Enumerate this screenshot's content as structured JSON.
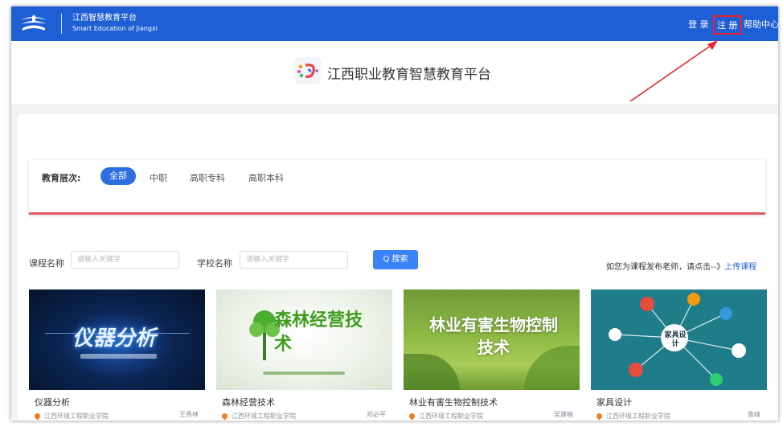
{
  "topbar": {
    "brand_cn": "江西智慧教育平台",
    "brand_en": "Smart Education of Jiangxi",
    "login": "登 录",
    "register": "注 册",
    "help": "帮助中心"
  },
  "platform": {
    "title": "江西职业教育智慧教育平台"
  },
  "filter": {
    "label": "教育层次:",
    "levels": [
      "全部",
      "中职",
      "高职专科",
      "高职本科"
    ],
    "selected": "全部"
  },
  "search": {
    "course_label": "课程名称",
    "course_placeholder": "请输入关键字",
    "school_label": "学校名称",
    "school_placeholder": "请输入关键字",
    "button": "Q 搜索",
    "upload_note": "如您为课程发布老师，请点击--》",
    "upload_link": "上传课程"
  },
  "courses": [
    {
      "title": "仪器分析",
      "school": "江西环境工程职业学院",
      "teacher": "王秀林",
      "thumb_text": "仪器分析"
    },
    {
      "title": "森林经营技术",
      "school": "江西环境工程职业学院",
      "teacher": "邓必平",
      "thumb_text": "森林经营技术"
    },
    {
      "title": "林业有害生物控制技术",
      "school": "江西环境工程职业学院",
      "teacher": "吴建嘛",
      "thumb_text": "林业有害生物控制技术"
    },
    {
      "title": "家具设计",
      "school": "江西环境工程职业学院",
      "teacher": "鲁峰",
      "thumb_text": "家具设计"
    }
  ],
  "colors": {
    "topbar": "#1f5fd6",
    "accent": "#2d6fe0",
    "highlight": "#e8232b"
  }
}
